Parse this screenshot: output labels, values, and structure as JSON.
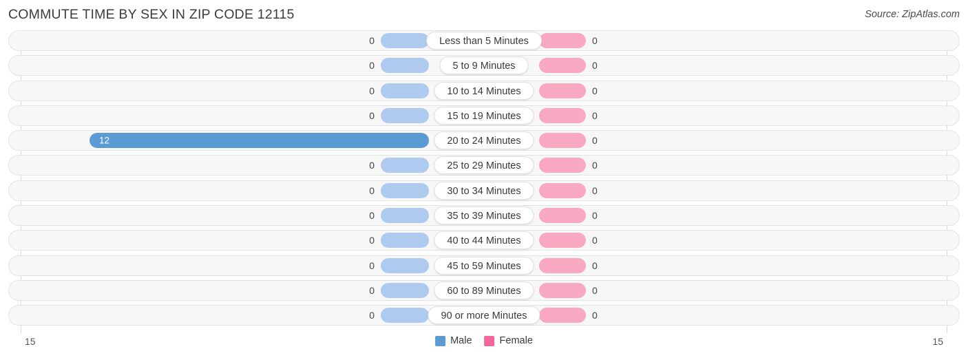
{
  "header": {
    "title": "COMMUTE TIME BY SEX IN ZIP CODE 12115",
    "source": "Source: ZipAtlas.com"
  },
  "axis": {
    "left_tick": "15",
    "right_tick": "15"
  },
  "legend": {
    "items": [
      {
        "label": "Male",
        "color": "#5b9bd5"
      },
      {
        "label": "Female",
        "color": "#f2669a"
      }
    ]
  },
  "colors": {
    "male_bar": "#aecbef",
    "male_bar_active": "#5b9bd5",
    "female_bar": "#f9a8c2",
    "female_bar_active": "#f26a9a",
    "track_fill": "#f7f7f7",
    "track_border": "#e3e3e3"
  },
  "chart_data": {
    "type": "bar",
    "title": "COMMUTE TIME BY SEX IN ZIP CODE 12115",
    "subtitle": "",
    "xlabel": "",
    "ylabel": "",
    "orientation": "horizontal",
    "style": "diverging-bidirectional",
    "legend_position": "bottom-center",
    "grid": false,
    "xlim": [
      15,
      15
    ],
    "axis_ticks": [
      "15",
      "15"
    ],
    "categories": [
      "Less than 5 Minutes",
      "5 to 9 Minutes",
      "10 to 14 Minutes",
      "15 to 19 Minutes",
      "20 to 24 Minutes",
      "25 to 29 Minutes",
      "30 to 34 Minutes",
      "35 to 39 Minutes",
      "40 to 44 Minutes",
      "45 to 59 Minutes",
      "60 to 89 Minutes",
      "90 or more Minutes"
    ],
    "series": [
      {
        "name": "Male",
        "values": [
          0,
          0,
          0,
          0,
          12,
          0,
          0,
          0,
          0,
          0,
          0,
          0
        ]
      },
      {
        "name": "Female",
        "values": [
          0,
          0,
          0,
          0,
          0,
          0,
          0,
          0,
          0,
          0,
          0,
          0
        ]
      }
    ]
  },
  "rows": [
    {
      "label": "Less than 5 Minutes",
      "male": "0",
      "female": "0",
      "male_len": 70,
      "female_len": 68,
      "male_active": false,
      "female_active": false,
      "male_inside": false,
      "female_inside": false
    },
    {
      "label": "5 to 9 Minutes",
      "male": "0",
      "female": "0",
      "male_len": 70,
      "female_len": 68,
      "male_active": false,
      "female_active": false,
      "male_inside": false,
      "female_inside": false
    },
    {
      "label": "10 to 14 Minutes",
      "male": "0",
      "female": "0",
      "male_len": 70,
      "female_len": 68,
      "male_active": false,
      "female_active": false,
      "male_inside": false,
      "female_inside": false
    },
    {
      "label": "15 to 19 Minutes",
      "male": "0",
      "female": "0",
      "male_len": 70,
      "female_len": 68,
      "male_active": false,
      "female_active": false,
      "male_inside": false,
      "female_inside": false
    },
    {
      "label": "20 to 24 Minutes",
      "male": "12",
      "female": "0",
      "male_len": 493,
      "female_len": 68,
      "male_active": true,
      "female_active": false,
      "male_inside": true,
      "female_inside": false
    },
    {
      "label": "25 to 29 Minutes",
      "male": "0",
      "female": "0",
      "male_len": 70,
      "female_len": 68,
      "male_active": false,
      "female_active": false,
      "male_inside": false,
      "female_inside": false
    },
    {
      "label": "30 to 34 Minutes",
      "male": "0",
      "female": "0",
      "male_len": 70,
      "female_len": 68,
      "male_active": false,
      "female_active": false,
      "male_inside": false,
      "female_inside": false
    },
    {
      "label": "35 to 39 Minutes",
      "male": "0",
      "female": "0",
      "male_len": 70,
      "female_len": 68,
      "male_active": false,
      "female_active": false,
      "male_inside": false,
      "female_inside": false
    },
    {
      "label": "40 to 44 Minutes",
      "male": "0",
      "female": "0",
      "male_len": 70,
      "female_len": 68,
      "male_active": false,
      "female_active": false,
      "male_inside": false,
      "female_inside": false
    },
    {
      "label": "45 to 59 Minutes",
      "male": "0",
      "female": "0",
      "male_len": 70,
      "female_len": 68,
      "male_active": false,
      "female_active": false,
      "male_inside": false,
      "female_inside": false
    },
    {
      "label": "60 to 89 Minutes",
      "male": "0",
      "female": "0",
      "male_len": 70,
      "female_len": 68,
      "male_active": false,
      "female_active": false,
      "male_inside": false,
      "female_inside": false
    },
    {
      "label": "90 or more Minutes",
      "male": "0",
      "female": "0",
      "male_len": 70,
      "female_len": 68,
      "male_active": false,
      "female_active": false,
      "male_inside": false,
      "female_inside": false
    }
  ]
}
